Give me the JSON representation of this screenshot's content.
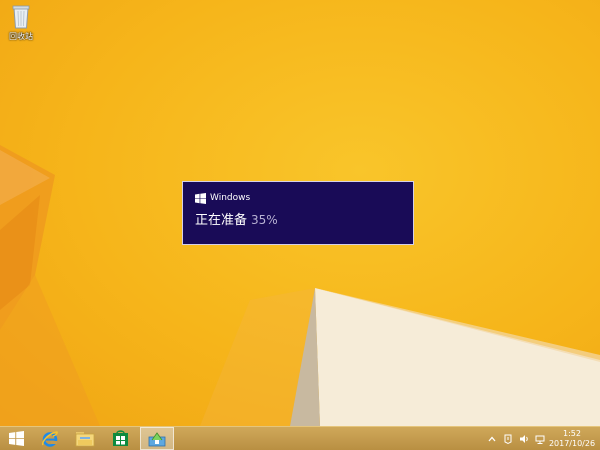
{
  "desktop": {
    "icons": [
      {
        "label": "回收站",
        "icon": "recycle-bin-icon"
      }
    ]
  },
  "dialog": {
    "brand": "Windows",
    "status": "正在准备",
    "percent": "35%",
    "progress": 0.35,
    "background": "#190b57"
  },
  "taskbar": {
    "buttons": [
      {
        "name": "start",
        "icon": "windows-logo-icon"
      },
      {
        "name": "internet-explorer",
        "icon": "ie-icon"
      },
      {
        "name": "file-explorer",
        "icon": "folder-icon"
      },
      {
        "name": "store",
        "icon": "store-icon"
      },
      {
        "name": "setup",
        "icon": "setup-icon"
      }
    ],
    "tray_icons": [
      "show-hidden-icons-icon",
      "action-center-icon",
      "volume-icon",
      "network-icon"
    ],
    "clock": {
      "time": "1:52",
      "date": "2017/10/26"
    }
  },
  "colors": {
    "wallpaper": "#f6b51a",
    "taskbar": "#c49a4c"
  }
}
